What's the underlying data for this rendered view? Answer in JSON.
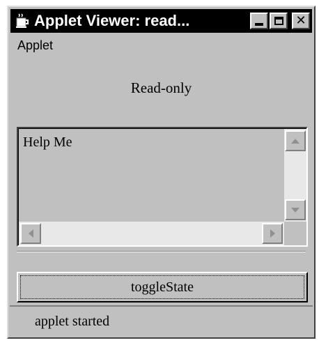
{
  "window": {
    "title": "Applet Viewer: read...",
    "icon": "coffee-cup-icon",
    "buttons": {
      "minimize": "minimize-icon",
      "maximize": "maximize-icon",
      "close": "✕"
    }
  },
  "menu": {
    "items": [
      "Applet"
    ]
  },
  "main": {
    "label": "Read-only",
    "textarea": {
      "value": "Help Me"
    },
    "button_label": "toggleState"
  },
  "status": {
    "text": "applet started"
  }
}
